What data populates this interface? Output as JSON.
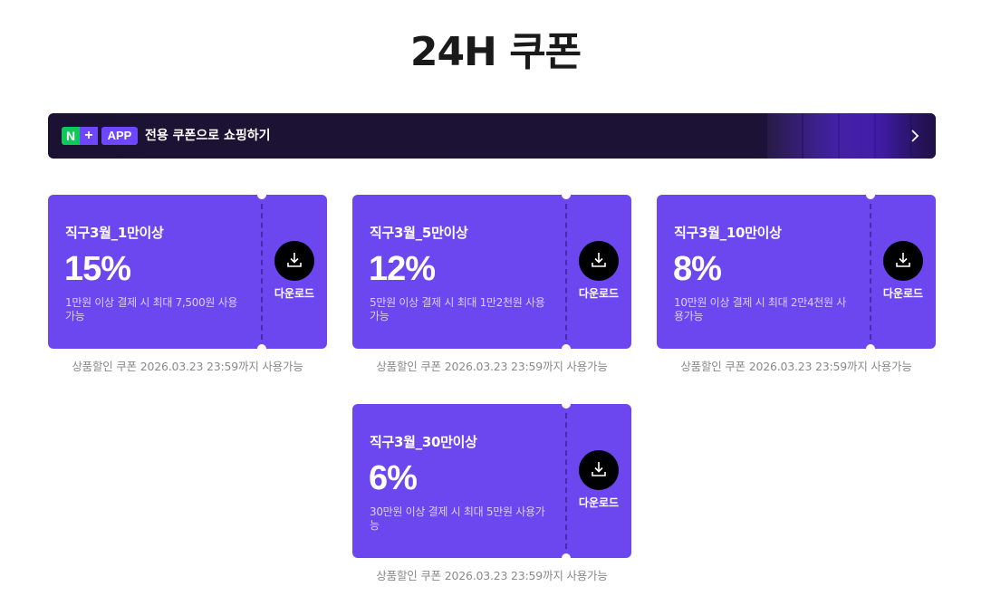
{
  "page": {
    "title": "24H 쿠폰"
  },
  "banner": {
    "badge_n": "N",
    "badge_plus": "+",
    "badge_app": "APP",
    "text": "전용 쿠폰으로 쇼핑하기",
    "chevron_icon": "chevron-right-icon"
  },
  "colors": {
    "coupon_bg": "#6c47ef",
    "banner_bg": "#1b1233",
    "badge_n": "#10c85a",
    "accent": "#6c47ff"
  },
  "coupons": [
    {
      "name": "직구3월_1만이상",
      "percent": "15%",
      "condition": "1만원 이상 결제 시 최대 7,500원 사용가능",
      "download_label": "다운로드",
      "validity": "상품할인 쿠폰 2026.03.23 23:59까지 사용가능"
    },
    {
      "name": "직구3월_5만이상",
      "percent": "12%",
      "condition": "5만원 이상 결제 시 최대 1만2천원 사용가능",
      "download_label": "다운로드",
      "validity": "상품할인 쿠폰 2026.03.23 23:59까지 사용가능"
    },
    {
      "name": "직구3월_10만이상",
      "percent": "8%",
      "condition": "10만원 이상 결제 시 최대 2만4천원 사용가능",
      "download_label": "다운로드",
      "validity": "상품할인 쿠폰 2026.03.23 23:59까지 사용가능"
    },
    {
      "name": "직구3월_30만이상",
      "percent": "6%",
      "condition": "30만원 이상 결제 시 최대 5만원 사용가능",
      "download_label": "다운로드",
      "validity": "상품할인 쿠폰 2026.03.23 23:59까지 사용가능"
    }
  ]
}
